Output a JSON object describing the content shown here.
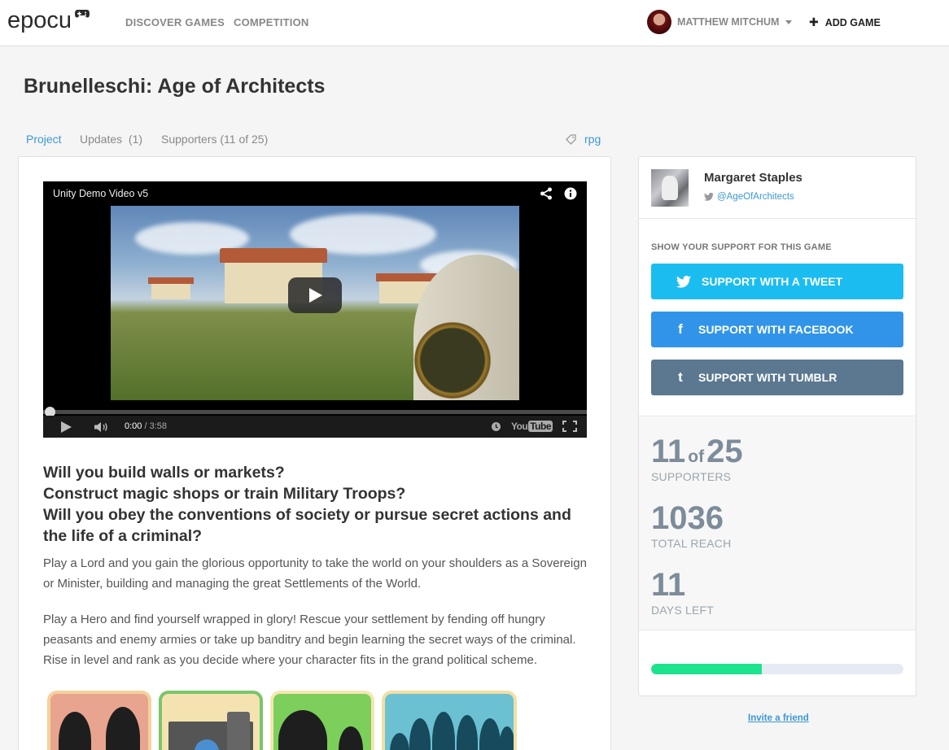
{
  "header": {
    "logo": "epocu",
    "nav": [
      "DISCOVER GAMES",
      "COMPETITION"
    ],
    "user_name": "MATTHEW MITCHUM",
    "add_game_label": "ADD GAME"
  },
  "page": {
    "title": "Brunelleschi: Age of Architects"
  },
  "tabs": [
    {
      "label": "Project",
      "active": true
    },
    {
      "label": "Updates  (1)",
      "active": false
    },
    {
      "label": "Supporters (11 of 25)",
      "active": false
    }
  ],
  "tag": {
    "label": "rpg",
    "icon": "tag-icon"
  },
  "video": {
    "title": "Unity Demo Video v5",
    "current_time": "0:00",
    "duration": " / 3:58",
    "progress": 0,
    "brand": "YouTube"
  },
  "article": {
    "headline": [
      "Will you build walls or markets?",
      "Construct magic shops or train Military Troops?",
      "Will you obey the conventions of society or pursue secret actions and the life of a criminal?"
    ],
    "paragraphs": [
      "Play a Lord and you gain the glorious opportunity to take the world on your shoulders as a Sovereign or Minister, building and managing the great Settlements of the World.",
      "Play a Hero and find yourself wrapped in glory! Rescue your settlement by fending off hungry peasants and enemy armies or take up banditry and begin learning the secret ways of the criminal. Rise in level and rank as you decide where your character fits in the grand political scheme."
    ]
  },
  "creator": {
    "name": "Margaret Staples",
    "handle": "@AgeOfArchitects"
  },
  "support": {
    "heading": "SHOW YOUR SUPPORT FOR THIS GAME",
    "buttons": [
      {
        "label": "SUPPORT WITH A TWEET",
        "icon": "twitter-icon",
        "color": "#1bbdf0"
      },
      {
        "label": "SUPPORT WITH FACEBOOK",
        "icon": "facebook-icon",
        "color": "#3194e9"
      },
      {
        "label": "SUPPORT WITH TUMBLR",
        "icon": "tumblr-icon",
        "color": "#5b7890"
      }
    ]
  },
  "stats": {
    "supporters": "11",
    "of_word": "of",
    "goal": "25",
    "supporters_label": "SUPPORTERS",
    "reach": "1036",
    "reach_label": "TOTAL REACH",
    "days": "11",
    "days_label": "DAYS LEFT",
    "progress_fraction": 0.44
  },
  "invite_label": "Invite a friend",
  "colors": {
    "accent": "#3b98d4",
    "progress": "#1de38f",
    "stat_text": "#7d8c9a"
  }
}
